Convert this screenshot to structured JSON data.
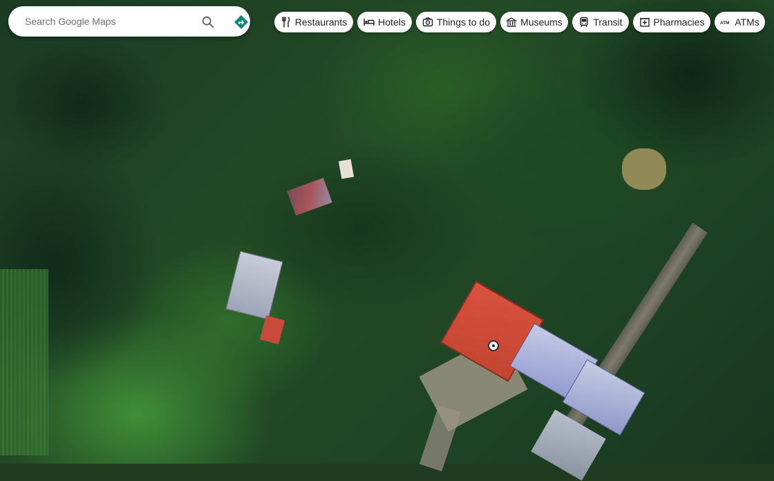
{
  "search": {
    "placeholder": "Search Google Maps",
    "value": "",
    "search_icon": "search-icon",
    "directions_icon": "directions-icon"
  },
  "categories": [
    {
      "label": "Restaurants",
      "icon": "restaurant-icon"
    },
    {
      "label": "Hotels",
      "icon": "hotel-icon"
    },
    {
      "label": "Things to do",
      "icon": "camera-icon"
    },
    {
      "label": "Museums",
      "icon": "museum-icon"
    },
    {
      "label": "Transit",
      "icon": "transit-icon"
    },
    {
      "label": "Pharmacies",
      "icon": "pharmacy-icon"
    },
    {
      "label": "ATMs",
      "icon": "atm-icon"
    }
  ],
  "map": {
    "view": "satellite",
    "marker_icon": "location-marker-icon"
  },
  "colors": {
    "directions": "#0b8a7a",
    "chip_background": "#ffffff",
    "text": "#202124"
  }
}
